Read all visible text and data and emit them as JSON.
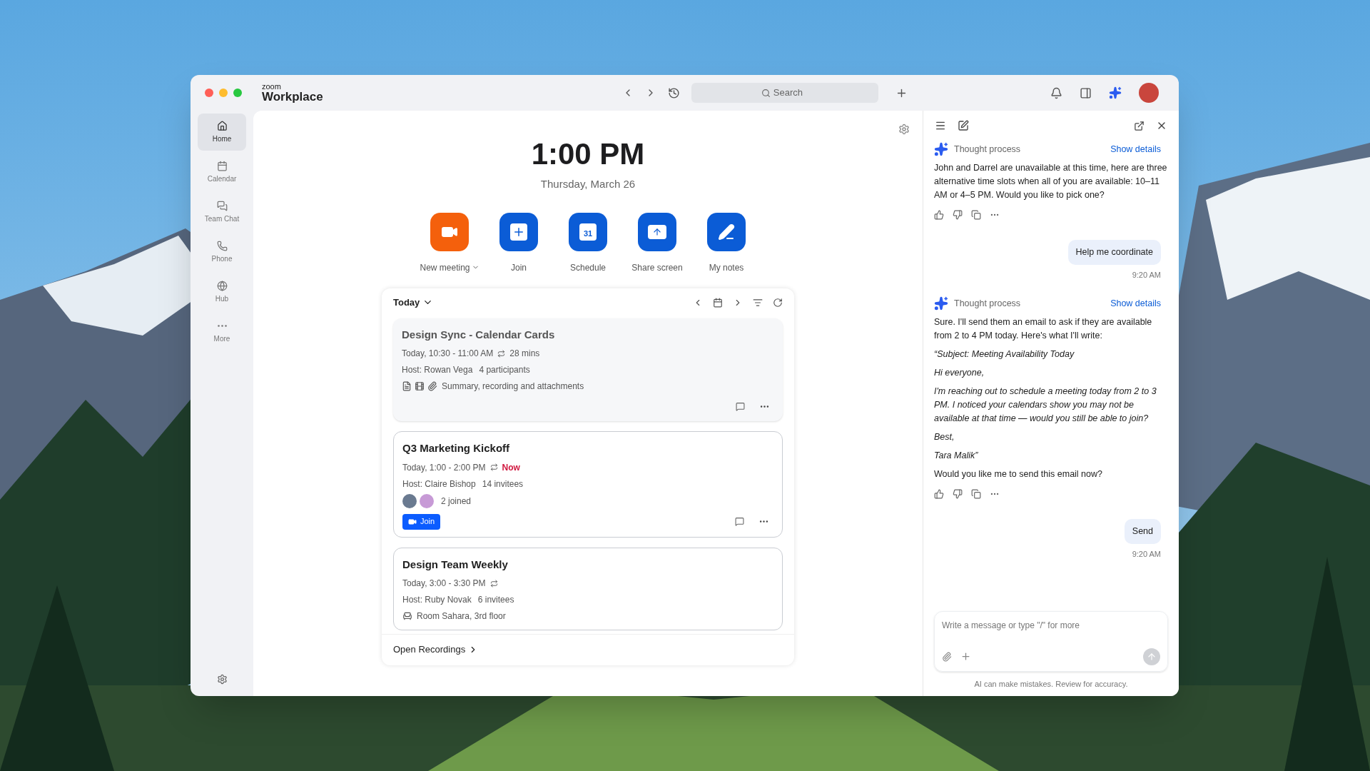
{
  "app": {
    "logo_small": "zoom",
    "logo_large": "Workplace"
  },
  "search": {
    "placeholder": "Search"
  },
  "sidebar": {
    "items": [
      {
        "label": "Home",
        "selected": true
      },
      {
        "label": "Calendar",
        "selected": false
      },
      {
        "label": "Team Chat",
        "selected": false
      },
      {
        "label": "Phone",
        "selected": false
      },
      {
        "label": "Hub",
        "selected": false
      },
      {
        "label": "More",
        "selected": false
      }
    ]
  },
  "clock": {
    "time": "1:00 PM",
    "date": "Thursday, March 26"
  },
  "actions": [
    {
      "label": "New meeting",
      "dropdown": true,
      "color": "#f4600c"
    },
    {
      "label": "Join",
      "dropdown": false,
      "color": "#0b5cd6"
    },
    {
      "label": "Schedule",
      "dropdown": false,
      "color": "#0b5cd6",
      "badge": "31"
    },
    {
      "label": "Share screen",
      "dropdown": false,
      "color": "#0b5cd6"
    },
    {
      "label": "My notes",
      "dropdown": false,
      "color": "#0b5cd6"
    }
  ],
  "agenda": {
    "filter": "Today",
    "meetings": [
      {
        "title": "Design Sync - Calendar Cards",
        "time": "Today, 10:30 - 11:00 AM",
        "status": "28 mins",
        "live": false,
        "past": true,
        "host": "Host: Rowan Vega",
        "people": "4 participants",
        "kind": "assets",
        "extra": "Summary, recording and attachments"
      },
      {
        "title": "Q3 Marketing Kickoff",
        "time": "Today, 1:00 - 2:00 PM",
        "status": "Now",
        "live": true,
        "past": false,
        "host": "Host: Claire Bishop",
        "people": "14 invitees",
        "kind": "joined",
        "extra": "2 joined",
        "join": "Join"
      },
      {
        "title": "Design Team Weekly",
        "time": "Today, 3:00 - 3:30 PM",
        "past": false,
        "host": "Host: Ruby Novak",
        "people": "6 invitees",
        "kind": "room",
        "extra": "Room Sahara, 3rd floor"
      }
    ],
    "footer": "Open Recordings"
  },
  "chat": {
    "messages": [
      {
        "kind": "assistant",
        "header": "Thought process",
        "link": "Show details",
        "paragraphs": [
          {
            "text": "John and Darrel are unavailable at this time, here are three alternative time slots when all of you are available: 10–11 AM or 4–5 PM. Would you like to pick one?",
            "italic": false
          }
        ]
      },
      {
        "kind": "user",
        "text": "Help me coordinate",
        "time": "9:20 AM"
      },
      {
        "kind": "assistant",
        "header": "Thought process",
        "link": "Show details",
        "paragraphs": [
          {
            "text": "Sure. I'll send them an email to ask if they are available from 2 to 4 PM today. Here's what I'll write:",
            "italic": false
          },
          {
            "text": "“Subject: Meeting Availability Today",
            "italic": true
          },
          {
            "text": "Hi everyone,",
            "italic": true
          },
          {
            "text": "I'm reaching out to schedule a meeting today from 2 to 3 PM. I noticed your calendars show you may not be available at that time — would you still be able to join?",
            "italic": true
          },
          {
            "text": "Best,",
            "italic": true
          },
          {
            "text": "Tara Malik”",
            "italic": true
          },
          {
            "text": "Would you like me to send this email now?",
            "italic": false
          }
        ]
      },
      {
        "kind": "user",
        "text": "Send",
        "time": "9:20 AM"
      }
    ],
    "composer": {
      "placeholder": "Write a message or type \"/\" for more"
    },
    "disclaimer": "AI can make mistakes. Review for accuracy."
  }
}
